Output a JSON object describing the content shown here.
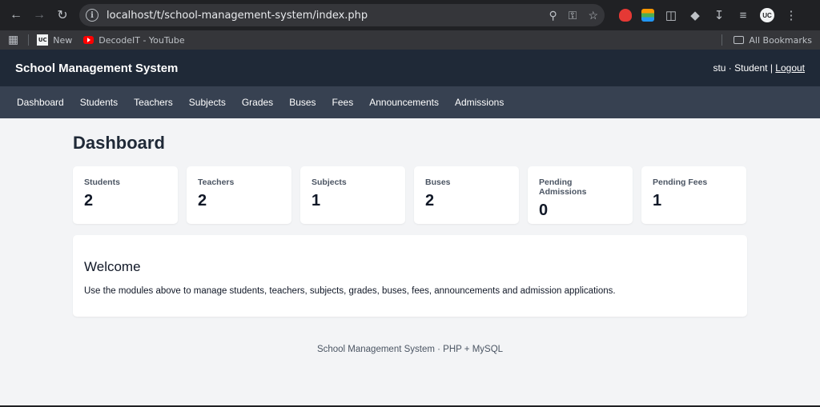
{
  "browser": {
    "url": "localhost/t/school-management-system/index.php",
    "profile_initials": "UC",
    "bookmarks": [
      {
        "label": "New",
        "icon": "uc-icon"
      },
      {
        "label": "DecodeIT - YouTube",
        "icon": "youtube-icon"
      }
    ],
    "all_bookmarks_label": "All Bookmarks"
  },
  "header": {
    "title": "School Management System",
    "user_info": "stu · Student |",
    "logout_label": "Logout"
  },
  "nav": {
    "items": [
      "Dashboard",
      "Students",
      "Teachers",
      "Subjects",
      "Grades",
      "Buses",
      "Fees",
      "Announcements",
      "Admissions"
    ]
  },
  "main": {
    "title": "Dashboard",
    "stats": [
      {
        "label": "Students",
        "value": "2"
      },
      {
        "label": "Teachers",
        "value": "2"
      },
      {
        "label": "Subjects",
        "value": "1"
      },
      {
        "label": "Buses",
        "value": "2"
      },
      {
        "label": "Pending Admissions",
        "value": "0"
      },
      {
        "label": "Pending Fees",
        "value": "1"
      }
    ],
    "welcome": {
      "heading": "Welcome",
      "text": "Use the modules above to manage students, teachers, subjects, grades, buses, fees, announcements and admission applications."
    }
  },
  "footer": {
    "text": "School Management System · PHP + MySQL"
  },
  "colors": {
    "header_bg": "#1f2937",
    "nav_bg": "#374151",
    "page_bg": "#f3f4f6"
  }
}
